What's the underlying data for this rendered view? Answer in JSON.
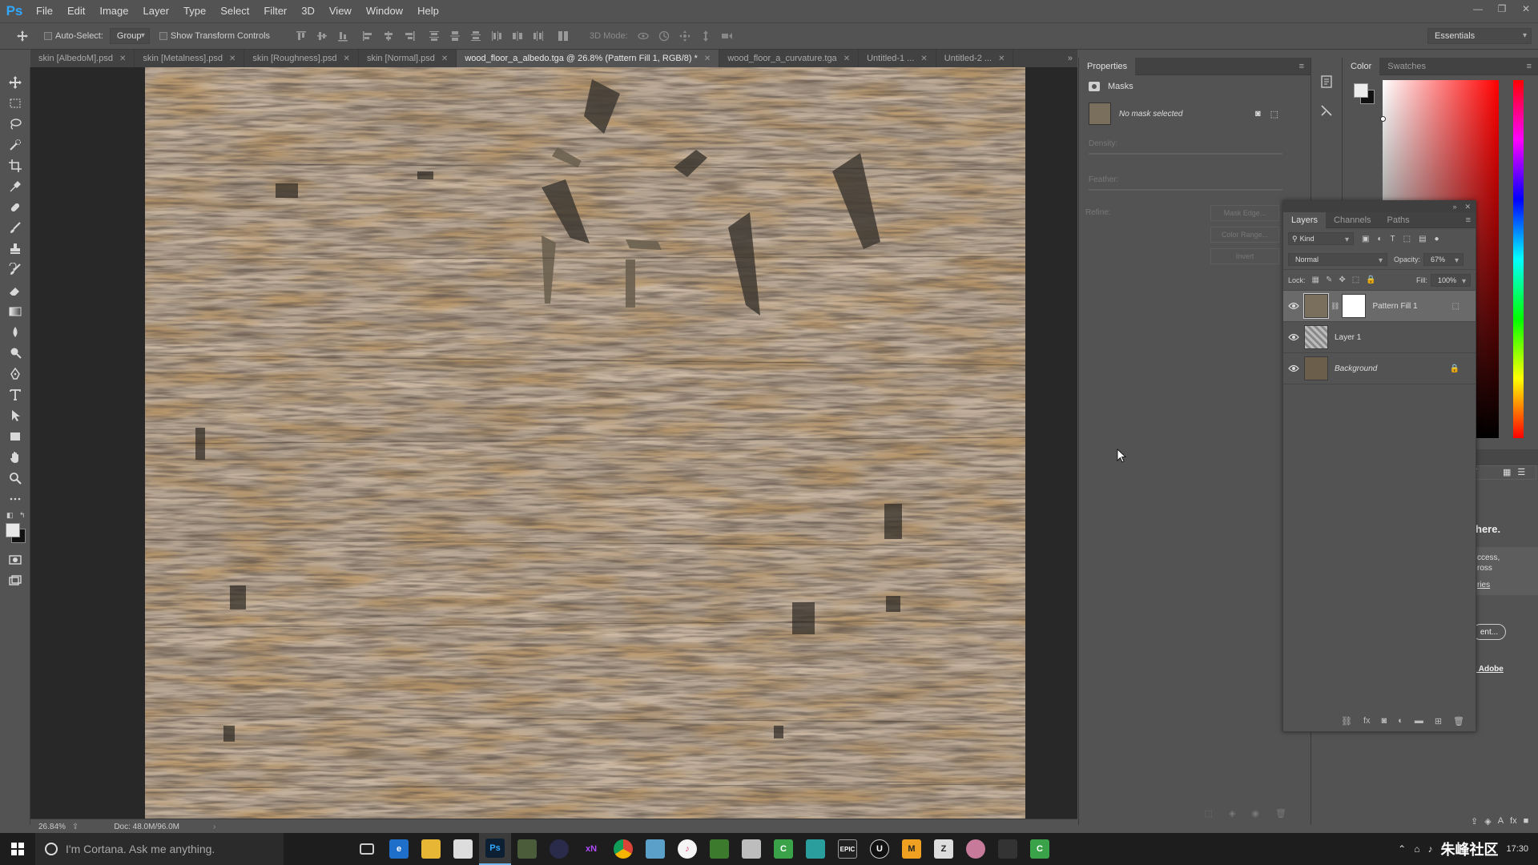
{
  "app": {
    "logo": "Ps",
    "menu": [
      "File",
      "Edit",
      "Image",
      "Layer",
      "Type",
      "Select",
      "Filter",
      "3D",
      "View",
      "Window",
      "Help"
    ]
  },
  "options_bar": {
    "auto_select_label": "Auto-Select:",
    "auto_select_value": "Group",
    "show_transform_label": "Show Transform Controls",
    "mode_3d_label": "3D Mode:",
    "workspace": "Essentials"
  },
  "tabs": [
    {
      "label": "skin [AlbedoM].psd"
    },
    {
      "label": "skin [Metalness].psd"
    },
    {
      "label": "skin [Roughness].psd"
    },
    {
      "label": "skin [Normal].psd"
    },
    {
      "label": "wood_floor_a_albedo.tga @ 26.8% (Pattern Fill 1, RGB/8) *"
    },
    {
      "label": "wood_floor_a_curvature.tga"
    },
    {
      "label": "Untitled-1 ..."
    },
    {
      "label": "Untitled-2 ..."
    }
  ],
  "status": {
    "zoom": "26.84%",
    "doc": "Doc: 48.0M/96.0M"
  },
  "properties": {
    "tab": "Properties",
    "section": "Masks",
    "mask_status": "No mask selected",
    "density_label": "Density:",
    "feather_label": "Feather:",
    "refine_label": "Refine:",
    "mask_edge_button": "Mask Edge...",
    "color_range_button": "Color Range...",
    "invert_button": "Invert"
  },
  "color_panel": {
    "tabs": [
      "Color",
      "Swatches"
    ]
  },
  "layers_panel": {
    "tabs": [
      "Layers",
      "Channels",
      "Paths"
    ],
    "filter_kind": "Kind",
    "blend_mode": "Normal",
    "opacity_label": "Opacity:",
    "opacity_value": "67%",
    "lock_label": "Lock:",
    "fill_label": "Fill:",
    "fill_value": "100%",
    "layers": [
      {
        "name": "Pattern Fill 1",
        "selected": true
      },
      {
        "name": "Layer 1",
        "selected": false
      },
      {
        "name": "Background",
        "selected": false
      }
    ]
  },
  "libraries_partial": {
    "heading": "here.",
    "line1": "ccess,",
    "line2": "ross",
    "link": "ries",
    "button": "ent...",
    "adobe_link": "t Adobe"
  },
  "taskbar": {
    "cortana_placeholder": "I'm Cortana. Ask me anything.",
    "active_app": "Ps",
    "watermark": "朱峰社区",
    "clock": "17:30"
  },
  "colors": {
    "accent": "#31a8ff",
    "panel_bg": "#535353",
    "canvas_bg": "#282828"
  }
}
